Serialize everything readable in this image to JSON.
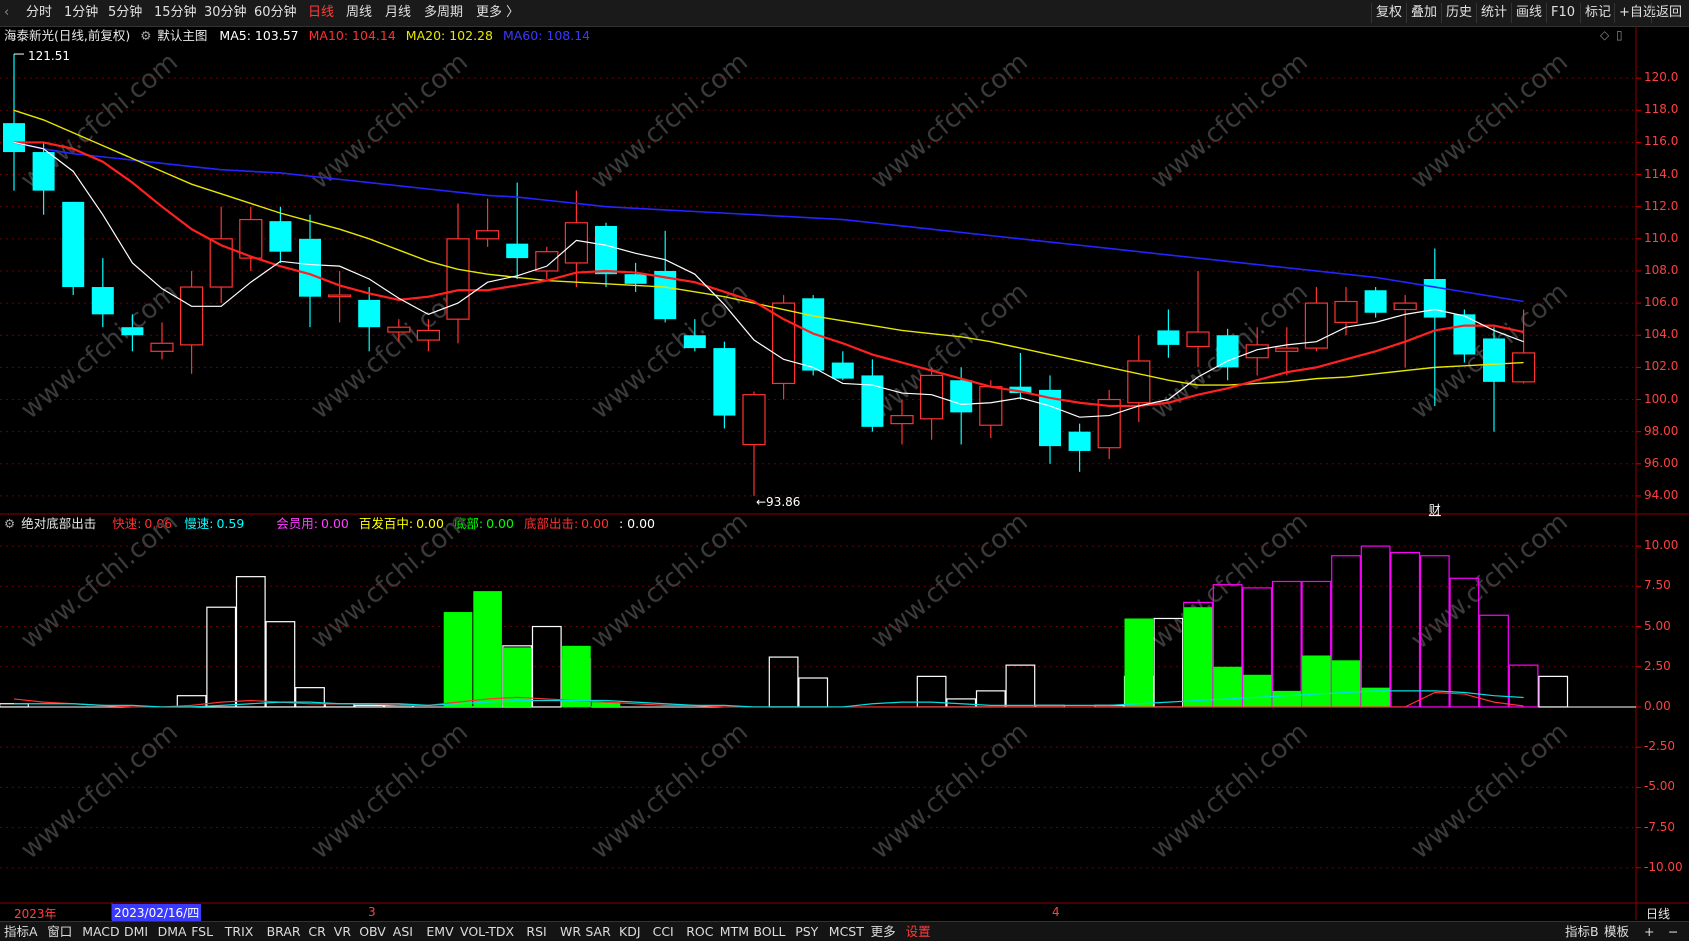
{
  "toolbar": {
    "left_glyph": "‹",
    "periods": [
      "分时",
      "1分钟",
      "5分钟",
      "15分钟",
      "30分钟",
      "60分钟",
      "日线",
      "周线",
      "月线",
      "多周期",
      "更多 〉"
    ],
    "active_period": "日线",
    "right_buttons": [
      "复权",
      "叠加",
      "历史",
      "统计",
      "画线",
      "F10",
      "标记",
      "+自选",
      "返回"
    ]
  },
  "main_header": {
    "stock_name": "海泰新光(日线,前复权)",
    "template_label": "默认主图",
    "ma5_label": "MA5: 103.57",
    "ma10_label": "MA10: 104.14",
    "ma20_label": "MA20: 102.28",
    "ma60_label": "MA60: 108.14"
  },
  "sub_header": {
    "indicator_name": "绝对底部出击",
    "fast_label": "快速:",
    "fast_value": "0.06",
    "slow_label": "慢速:",
    "slow_value": "0.59",
    "member_label": "会员用:",
    "member_value": "0.00",
    "hit_label": "百发百中:",
    "hit_value": "0.00",
    "bottom_label": "底部:",
    "bottom_value": "0.00",
    "strike_label": "底部出击:",
    "strike_value": "0.00",
    "extra_value": ": 0.00"
  },
  "price_annotations": {
    "high": "121.51",
    "low": "←93.86",
    "finance_tag": "财"
  },
  "price_axis": [
    "120.0",
    "118.0",
    "116.0",
    "114.0",
    "112.0",
    "110.0",
    "108.0",
    "106.0",
    "104.0",
    "102.0",
    "100.0",
    "98.00",
    "96.00",
    "94.00"
  ],
  "indicator_axis": [
    "10.00",
    "7.50",
    "5.00",
    "2.50",
    "0.00",
    "-2.50",
    "-5.00",
    "-7.50",
    "-10.00"
  ],
  "date_axis": {
    "year_label": "2023年",
    "cursor_date": "2023/02/16/四",
    "month3": "3",
    "month4": "4",
    "period_label": "日线"
  },
  "watermark": "www.cfchi.com",
  "bottom_tabs": [
    "指标A",
    "窗口",
    "MACD",
    "DMI",
    "DMA",
    "FSL",
    "TRIX",
    "BRAR",
    "CR",
    "VR",
    "OBV",
    "ASI",
    "EMV",
    "VOL-TDX",
    "RSI",
    "WR",
    "SAR",
    "KDJ",
    "CCI",
    "ROC",
    "MTM",
    "BOLL",
    "PSY",
    "MCST",
    "更多",
    "设置"
  ],
  "bottom_right": [
    "指标B",
    "模板",
    "+",
    "−"
  ],
  "colors": {
    "up": "#ff3232",
    "down": "#00ffff",
    "ma5": "#ffffff",
    "ma10": "#ff2020",
    "ma20": "#e6e600",
    "ma60": "#2424ff",
    "green": "#00ff00",
    "magenta": "#ff00ff"
  },
  "chart_data": [
    {
      "type": "candlestick",
      "title": "海泰新光(日线,前复权)",
      "ylim": [
        93,
        122
      ],
      "candles": [
        {
          "o": 117.2,
          "h": 121.5,
          "l": 113.0,
          "c": 115.4
        },
        {
          "o": 115.4,
          "h": 116.0,
          "l": 111.5,
          "c": 113.0
        },
        {
          "o": 112.3,
          "h": 112.3,
          "l": 106.5,
          "c": 107.0
        },
        {
          "o": 107.0,
          "h": 108.8,
          "l": 104.5,
          "c": 105.3
        },
        {
          "o": 104.5,
          "h": 105.3,
          "l": 103.0,
          "c": 104.0
        },
        {
          "o": 103.0,
          "h": 104.8,
          "l": 102.5,
          "c": 103.5
        },
        {
          "o": 103.4,
          "h": 108.0,
          "l": 101.6,
          "c": 107.0
        },
        {
          "o": 107.0,
          "h": 112.0,
          "l": 106.0,
          "c": 110.0
        },
        {
          "o": 108.8,
          "h": 112.0,
          "l": 108.0,
          "c": 111.2
        },
        {
          "o": 111.1,
          "h": 112.0,
          "l": 108.5,
          "c": 109.2
        },
        {
          "o": 110.0,
          "h": 111.5,
          "l": 104.5,
          "c": 106.4
        },
        {
          "o": 106.4,
          "h": 108.0,
          "l": 104.8,
          "c": 106.5
        },
        {
          "o": 106.2,
          "h": 107.0,
          "l": 103.0,
          "c": 104.5
        },
        {
          "o": 104.2,
          "h": 105.0,
          "l": 103.6,
          "c": 104.5
        },
        {
          "o": 103.7,
          "h": 105.0,
          "l": 103.0,
          "c": 104.3
        },
        {
          "o": 105.0,
          "h": 112.2,
          "l": 103.5,
          "c": 110.0
        },
        {
          "o": 110.0,
          "h": 112.5,
          "l": 109.5,
          "c": 110.5
        },
        {
          "o": 109.7,
          "h": 113.5,
          "l": 107.5,
          "c": 108.8
        },
        {
          "o": 108.0,
          "h": 109.5,
          "l": 107.5,
          "c": 109.2
        },
        {
          "o": 108.5,
          "h": 113.0,
          "l": 107.0,
          "c": 111.0
        },
        {
          "o": 110.8,
          "h": 111.0,
          "l": 107.0,
          "c": 107.8
        },
        {
          "o": 107.8,
          "h": 108.5,
          "l": 106.7,
          "c": 107.2
        },
        {
          "o": 108.0,
          "h": 110.5,
          "l": 104.8,
          "c": 105.0
        },
        {
          "o": 104.0,
          "h": 105.0,
          "l": 103.0,
          "c": 103.2
        },
        {
          "o": 103.2,
          "h": 103.6,
          "l": 98.2,
          "c": 99.0
        },
        {
          "o": 97.2,
          "h": 100.5,
          "l": 94.0,
          "c": 100.3
        },
        {
          "o": 101.0,
          "h": 106.5,
          "l": 100.0,
          "c": 106.0
        },
        {
          "o": 106.3,
          "h": 106.5,
          "l": 101.5,
          "c": 101.8
        },
        {
          "o": 102.3,
          "h": 103.0,
          "l": 101.2,
          "c": 101.3
        },
        {
          "o": 101.5,
          "h": 102.5,
          "l": 98.0,
          "c": 98.3
        },
        {
          "o": 98.5,
          "h": 100.0,
          "l": 97.2,
          "c": 99.0
        },
        {
          "o": 98.8,
          "h": 102.0,
          "l": 97.5,
          "c": 101.5
        },
        {
          "o": 101.2,
          "h": 102.0,
          "l": 97.2,
          "c": 99.2
        },
        {
          "o": 98.4,
          "h": 101.2,
          "l": 97.6,
          "c": 100.8
        },
        {
          "o": 100.8,
          "h": 102.9,
          "l": 100.0,
          "c": 100.4
        },
        {
          "o": 100.6,
          "h": 101.5,
          "l": 96.0,
          "c": 97.1
        },
        {
          "o": 98.0,
          "h": 98.5,
          "l": 95.5,
          "c": 96.8
        },
        {
          "o": 97.0,
          "h": 100.6,
          "l": 96.3,
          "c": 100.0
        },
        {
          "o": 99.8,
          "h": 104.0,
          "l": 98.6,
          "c": 102.4
        },
        {
          "o": 104.3,
          "h": 105.6,
          "l": 102.6,
          "c": 103.4
        },
        {
          "o": 103.3,
          "h": 108.0,
          "l": 102.0,
          "c": 104.2
        },
        {
          "o": 104.0,
          "h": 104.4,
          "l": 101.2,
          "c": 102.0
        },
        {
          "o": 102.6,
          "h": 104.5,
          "l": 101.5,
          "c": 103.4
        },
        {
          "o": 103.0,
          "h": 104.5,
          "l": 101.5,
          "c": 103.2
        },
        {
          "o": 103.2,
          "h": 107.0,
          "l": 103.0,
          "c": 106.0
        },
        {
          "o": 104.8,
          "h": 107.0,
          "l": 104.0,
          "c": 106.1
        },
        {
          "o": 106.8,
          "h": 107.0,
          "l": 105.1,
          "c": 105.4
        },
        {
          "o": 105.6,
          "h": 106.5,
          "l": 102.0,
          "c": 106.0
        },
        {
          "o": 107.5,
          "h": 109.4,
          "l": 99.6,
          "c": 105.1
        },
        {
          "o": 105.3,
          "h": 105.6,
          "l": 102.3,
          "c": 102.8
        },
        {
          "o": 103.8,
          "h": 104.5,
          "l": 98.0,
          "c": 101.1
        },
        {
          "o": 101.1,
          "h": 105.6,
          "l": 101.0,
          "c": 102.9
        }
      ],
      "ma5": [
        116.0,
        115.6,
        114.2,
        111.5,
        108.5,
        106.9,
        105.8,
        105.8,
        107.3,
        108.6,
        108.4,
        108.3,
        107.5,
        106.3,
        105.3,
        106.0,
        107.3,
        107.7,
        108.3,
        109.9,
        109.6,
        109.1,
        108.7,
        107.8,
        105.9,
        103.7,
        102.5,
        102.0,
        101.0,
        100.9,
        100.4,
        100.3,
        99.7,
        99.8,
        100.1,
        99.6,
        98.9,
        99.0,
        99.6,
        100.0,
        101.4,
        102.4,
        103.1,
        103.4,
        103.6,
        104.5,
        104.8,
        105.3,
        105.6,
        105.2,
        104.3,
        103.6
      ],
      "ma10": [
        116.0,
        116.0,
        115.6,
        114.8,
        113.5,
        112.0,
        110.6,
        109.6,
        108.9,
        108.3,
        107.8,
        107.1,
        106.6,
        106.2,
        106.4,
        106.8,
        106.8,
        107.1,
        107.4,
        107.9,
        108.0,
        107.9,
        107.6,
        107.3,
        106.7,
        106.1,
        105.0,
        104.1,
        103.5,
        102.8,
        102.3,
        101.8,
        101.3,
        100.8,
        100.5,
        100.1,
        99.8,
        99.6,
        99.6,
        99.8,
        100.3,
        100.7,
        101.2,
        101.7,
        102.0,
        102.5,
        103.0,
        103.6,
        104.3,
        104.6,
        104.6,
        104.2
      ],
      "ma20": [
        118.0,
        117.4,
        116.6,
        115.8,
        115.0,
        114.2,
        113.4,
        112.8,
        112.2,
        111.6,
        111.1,
        110.6,
        110.0,
        109.3,
        108.6,
        108.1,
        107.8,
        107.6,
        107.4,
        107.3,
        107.2,
        107.1,
        107.0,
        106.7,
        106.4,
        106.0,
        105.6,
        105.2,
        104.9,
        104.6,
        104.3,
        104.1,
        103.9,
        103.6,
        103.2,
        102.8,
        102.4,
        102.0,
        101.6,
        101.2,
        100.9,
        100.9,
        101.0,
        101.1,
        101.3,
        101.4,
        101.6,
        101.8,
        102.0,
        102.1,
        102.2,
        102.3
      ],
      "ma60": [
        116.0,
        115.6,
        115.3,
        115.1,
        114.9,
        114.7,
        114.5,
        114.3,
        114.2,
        114.1,
        113.9,
        113.7,
        113.5,
        113.3,
        113.1,
        112.9,
        112.7,
        112.6,
        112.4,
        112.2,
        112.0,
        111.9,
        111.8,
        111.7,
        111.6,
        111.5,
        111.4,
        111.3,
        111.2,
        111.0,
        110.8,
        110.6,
        110.4,
        110.2,
        110.0,
        109.8,
        109.6,
        109.4,
        109.2,
        109.0,
        108.8,
        108.6,
        108.4,
        108.2,
        108.0,
        107.8,
        107.6,
        107.3,
        107.0,
        106.7,
        106.4,
        106.1
      ]
    },
    {
      "type": "bar",
      "title": "绝对底部出击",
      "ylim": [
        -12,
        11
      ],
      "white_bars": [
        0.2,
        0,
        0,
        0,
        0,
        0,
        0.7,
        6.2,
        8.1,
        5.3,
        1.2,
        0.2,
        0.1,
        0.1,
        0,
        0,
        0,
        3.8,
        5.0,
        3.0,
        0,
        0,
        0,
        0,
        0,
        0,
        3.1,
        1.8,
        0,
        0,
        0,
        1.9,
        0.5,
        1.0,
        2.6,
        0.1,
        0,
        0.1,
        1.9,
        5.5,
        6.5,
        7.6,
        7.4,
        7.8,
        7.8,
        9.4,
        10.0,
        9.6,
        9.4,
        8.0,
        5.7,
        2.6,
        1.9
      ],
      "green_bars": [
        0,
        0,
        0,
        0,
        0,
        0,
        0,
        0,
        0,
        0,
        0,
        0,
        0,
        0,
        0,
        5.9,
        7.2,
        3.7,
        0,
        3.8,
        0.3,
        0,
        0,
        0,
        0,
        0,
        0,
        0,
        0,
        0,
        0,
        0,
        0,
        0,
        0,
        0,
        0,
        0,
        5.5,
        0,
        6.2,
        2.5,
        2.0,
        1.0,
        3.2,
        2.9,
        1.2,
        0,
        0,
        0,
        0,
        0
      ],
      "magenta_bars": [
        0,
        0,
        0,
        0,
        0,
        0,
        0,
        0,
        0,
        0,
        0,
        0,
        0,
        0,
        0,
        0,
        0,
        0,
        0,
        5.0,
        5.8,
        4.5,
        2.2,
        0,
        0,
        0,
        0,
        0,
        0,
        0,
        0,
        0,
        0,
        0,
        0,
        0,
        0,
        0,
        0,
        0,
        7.7,
        7.4,
        7.8,
        7.8,
        9.4,
        10.0,
        9.6,
        9.4,
        8.0,
        5.7,
        2.6,
        1.9
      ],
      "fast": [
        0.5,
        0.3,
        0.2,
        0.1,
        0,
        0,
        0.1,
        0.3,
        0.4,
        0.3,
        0.2,
        0.2,
        0.2,
        0.1,
        0.1,
        0.3,
        0.5,
        0.6,
        0.5,
        0.4,
        0.3,
        0.2,
        0.1,
        0.1,
        0,
        0,
        0,
        0,
        0,
        0,
        0,
        0,
        0,
        0,
        0,
        0,
        0,
        0,
        0,
        0,
        0,
        0,
        0,
        0,
        0,
        0,
        0,
        0,
        0.9,
        0.8,
        0.3,
        0.06
      ],
      "slow": [
        0.2,
        0.2,
        0.2,
        0.1,
        0.1,
        0,
        0,
        0.1,
        0.2,
        0.3,
        0.3,
        0.2,
        0.2,
        0.2,
        0.1,
        0.2,
        0.3,
        0.4,
        0.4,
        0.4,
        0.4,
        0.3,
        0.2,
        0.1,
        0.1,
        0,
        0,
        0,
        0,
        0.2,
        0.3,
        0.3,
        0.2,
        0.1,
        0.1,
        0.1,
        0.1,
        0.1,
        0.2,
        0.3,
        0.4,
        0.5,
        0.6,
        0.7,
        0.8,
        0.9,
        1.0,
        1.0,
        1.0,
        0.9,
        0.7,
        0.59
      ]
    }
  ]
}
